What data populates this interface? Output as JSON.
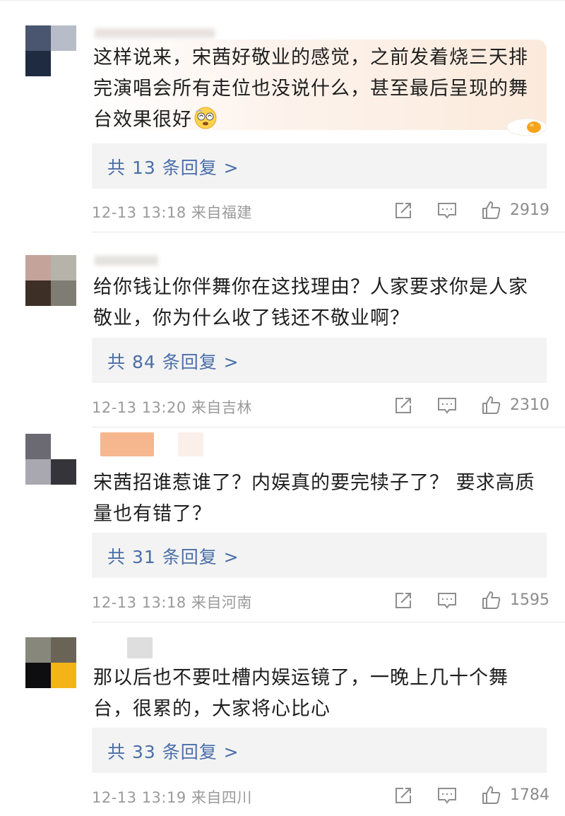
{
  "comments": [
    {
      "text": "这样说来，宋茜好敬业的感觉，之前发着烧三天排完演唱会所有走位也没说什么，甚至最后呈现的舞台效果很好",
      "emoji": "dizzy-face-emoji",
      "replies_label": "共 13 条回复 >",
      "timestamp": "12-13 13:18",
      "location": "来自福建",
      "likes": "2919",
      "avatar_colors": [
        "#4a5670",
        "#b7bcc8",
        "#1f2b40",
        "#f0f0f0"
      ]
    },
    {
      "text": "给你钱让你伴舞你在这找理由？人家要求你是人家敬业，你为什么收了钱还不敬业啊？",
      "replies_label": "共 84 条回复 >",
      "timestamp": "12-13 13:20",
      "location": "来自吉林",
      "likes": "2310",
      "avatar_colors": [
        "#c4a39a",
        "#b6b3ab",
        "#3e2f26",
        "#7f7c74"
      ]
    },
    {
      "text": "宋茜招谁惹谁了？内娱真的要完犊子了？ 要求高质量也有错了？",
      "replies_label": "共 31 条回复 >",
      "timestamp": "12-13 13:18",
      "location": "来自河南",
      "likes": "1595",
      "avatar_colors": [
        "#6b6a72",
        "#f4f4f4",
        "#a9a8b1",
        "#35343b"
      ]
    },
    {
      "text": "那以后也不要吐槽内娱运镜了，一晚上几十个舞台，很累的，大家将心比心",
      "replies_label": "共 33 条回复 >",
      "timestamp": "12-13 13:19",
      "location": "来自四川",
      "likes": "1784",
      "avatar_colors": [
        "#88877c",
        "#6a6457",
        "#0e0e10",
        "#f4b417"
      ]
    }
  ],
  "icons": {
    "share": "share-icon",
    "reply": "comment-icon",
    "like": "thumbs-up-icon"
  },
  "colors": {
    "link": "#4a6ea9",
    "meta": "#9a9a9a",
    "reply_bg": "#f3f3f3"
  }
}
